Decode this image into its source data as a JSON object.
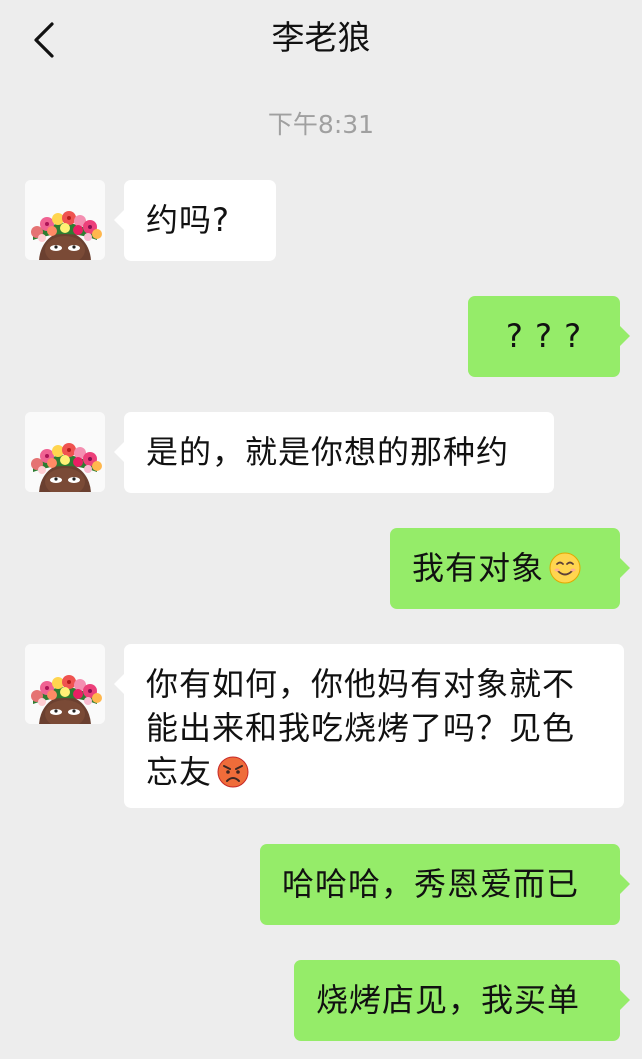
{
  "header": {
    "title": "李老狼",
    "back_icon": "chevron-left-icon"
  },
  "timestamp": "下午8:31",
  "colors": {
    "background": "#ededed",
    "received_bubble": "#ffffff",
    "sent_bubble": "#95ec69",
    "timestamp": "#a0a0a0"
  },
  "messages": [
    {
      "side": "received",
      "text": "约吗?"
    },
    {
      "side": "sent",
      "text": "? ? ?"
    },
    {
      "side": "received",
      "text": "是的，就是你想的那种约"
    },
    {
      "side": "sent",
      "text": "我有对象",
      "emoji": "smile-emoji"
    },
    {
      "side": "received",
      "lines": [
        "你有如何，你他妈有对象就不",
        "能出来和我吃烧烤了吗？见色",
        "忘友"
      ],
      "emoji": "angry-emoji"
    },
    {
      "side": "sent",
      "text": "哈哈哈，秀恩爱而已"
    },
    {
      "side": "sent",
      "text": "烧烤店见，我买单"
    }
  ]
}
